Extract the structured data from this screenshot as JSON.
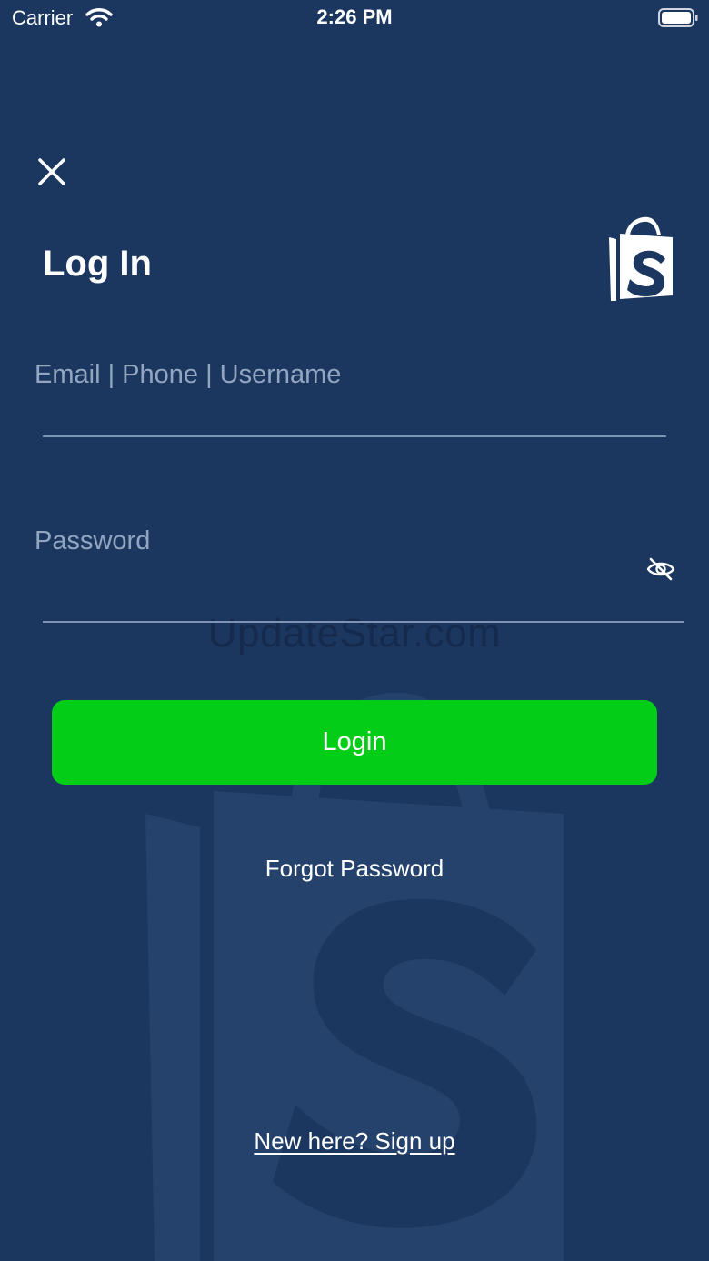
{
  "status_bar": {
    "carrier": "Carrier",
    "time": "2:26 PM",
    "wifi_icon": "wifi-icon",
    "battery_icon": "battery-full-icon"
  },
  "header": {
    "close_icon": "close-icon",
    "title": "Log In",
    "logo_icon": "shopping-bag-s-logo"
  },
  "form": {
    "identifier_placeholder": "Email | Phone | Username",
    "identifier_value": "",
    "password_placeholder": "Password",
    "password_value": "",
    "password_toggle_icon": "eye-off-icon",
    "login_label": "Login",
    "forgot_label": "Forgot Password",
    "signup_label": "New here? Sign up"
  },
  "watermark": "UpdateStar.com",
  "colors": {
    "background": "#1b3760",
    "login_button": "#03cd17",
    "placeholder": "#93a6c1",
    "divider": "#7d93b3"
  }
}
